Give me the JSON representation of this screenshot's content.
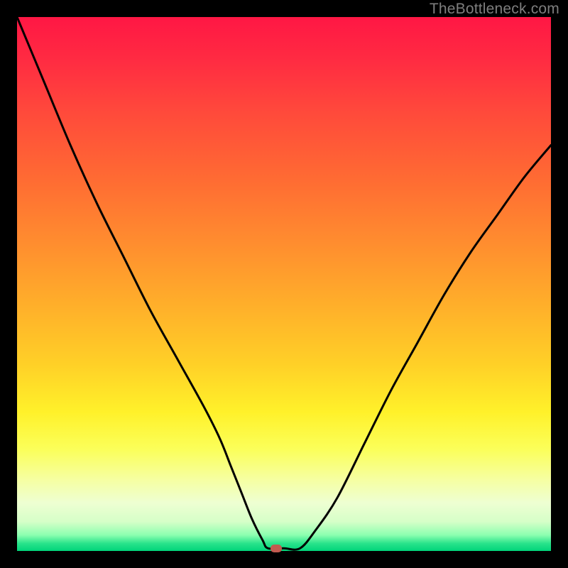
{
  "watermark": "TheBottleneck.com",
  "colors": {
    "curve_stroke": "#000000",
    "marker_fill": "#c25a4f",
    "frame_bg": "#000000"
  },
  "chart_data": {
    "type": "line",
    "title": "",
    "xlabel": "",
    "ylabel": "",
    "xlim": [
      0,
      100
    ],
    "ylim": [
      0,
      100
    ],
    "grid": false,
    "legend": false,
    "axes_visible": false,
    "series": [
      {
        "name": "bottleneck-curve",
        "x": [
          0,
          5,
          10,
          15,
          20,
          25,
          30,
          35,
          38,
          40,
          42,
          44,
          46,
          47,
          50,
          53,
          56,
          60,
          65,
          70,
          75,
          80,
          85,
          90,
          95,
          100
        ],
        "y": [
          100,
          88,
          76,
          65,
          55,
          45,
          36,
          27,
          21,
          16,
          11,
          6,
          2,
          0.5,
          0.5,
          0.5,
          4,
          10,
          20,
          30,
          39,
          48,
          56,
          63,
          70,
          76
        ]
      }
    ],
    "marker": {
      "x": 48.5,
      "y": 0.5,
      "shape": "rounded-rect"
    }
  }
}
